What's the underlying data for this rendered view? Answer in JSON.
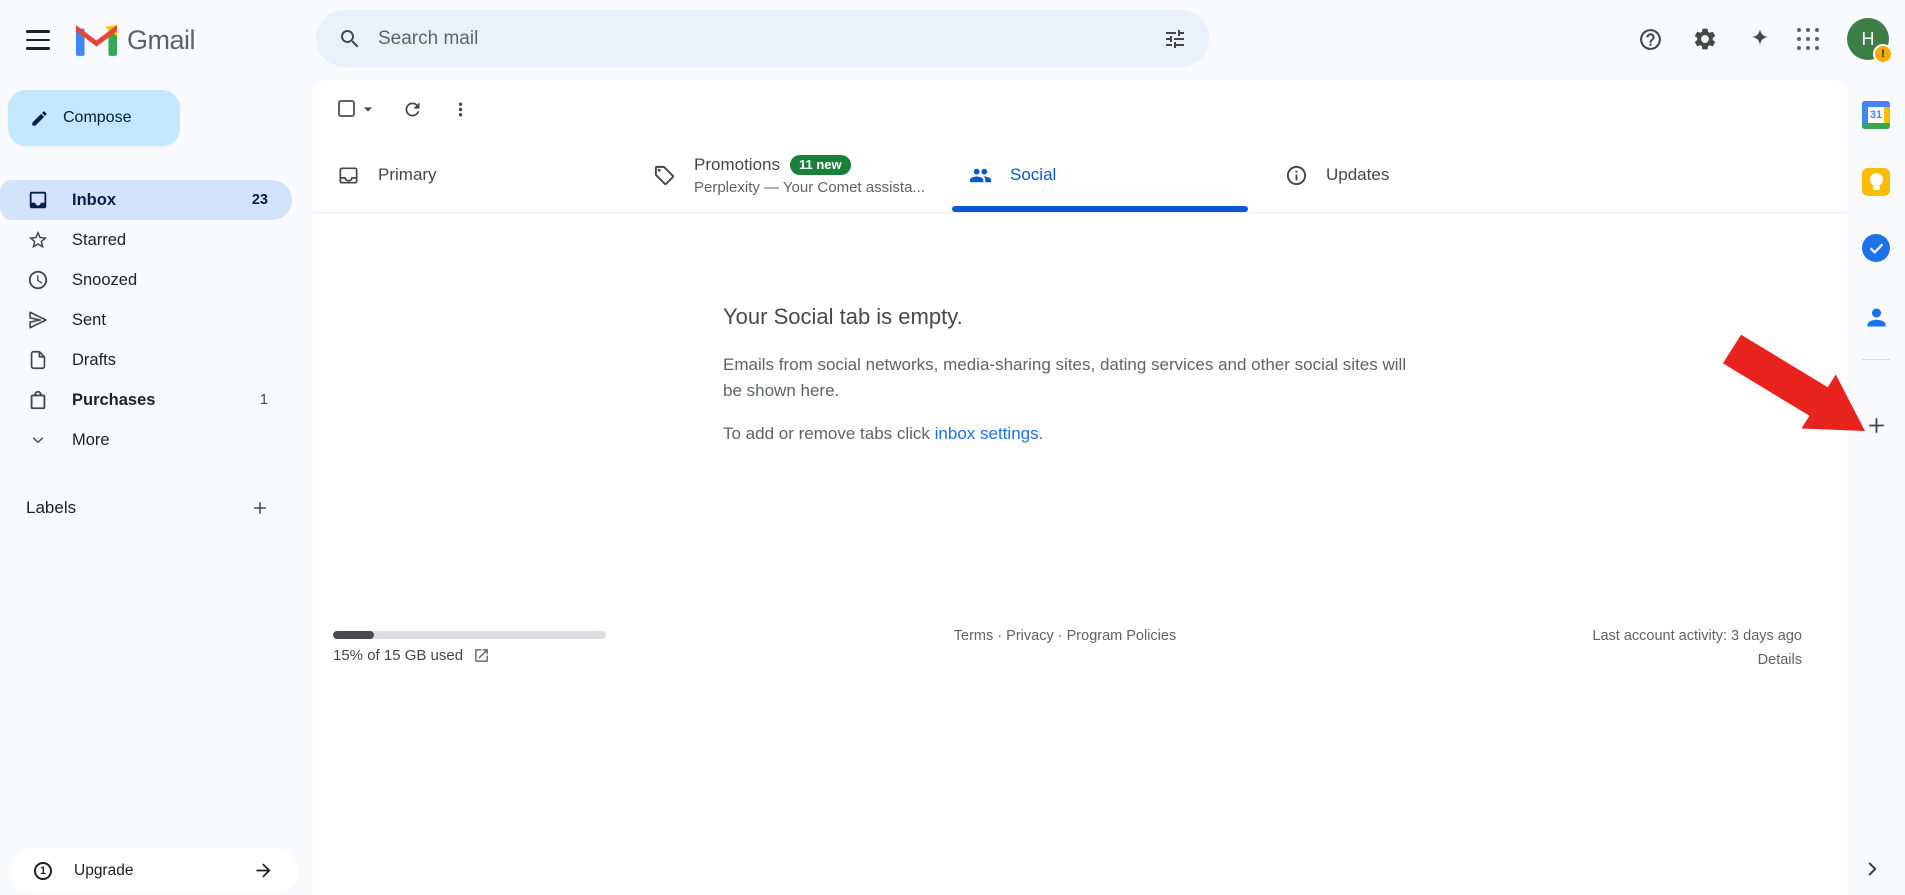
{
  "header": {
    "app_name": "Gmail",
    "search_placeholder": "Search mail",
    "avatar_letter": "H",
    "avatar_badge": "!"
  },
  "sidebar": {
    "compose": "Compose",
    "items": [
      {
        "label": "Inbox",
        "count": "23"
      },
      {
        "label": "Starred",
        "count": ""
      },
      {
        "label": "Snoozed",
        "count": ""
      },
      {
        "label": "Sent",
        "count": ""
      },
      {
        "label": "Drafts",
        "count": ""
      },
      {
        "label": "Purchases",
        "count": "1"
      },
      {
        "label": "More",
        "count": ""
      }
    ],
    "labels_title": "Labels",
    "upgrade": {
      "label": "Upgrade",
      "badge": "1"
    }
  },
  "tabs": {
    "primary": {
      "label": "Primary"
    },
    "promotions": {
      "label": "Promotions",
      "badge": "11 new",
      "preview": "Perplexity — Your Comet assista..."
    },
    "social": {
      "label": "Social"
    },
    "updates": {
      "label": "Updates"
    }
  },
  "empty_state": {
    "title": "Your Social tab is empty.",
    "description": "Emails from social networks, media-sharing sites, dating services and other social sites will be shown here.",
    "cta_prefix": "To add or remove tabs click ",
    "cta_link": "inbox settings",
    "cta_suffix": "."
  },
  "footer": {
    "storage_text": "15% of 15 GB used",
    "storage_percent": 15,
    "links": [
      "Terms",
      "Privacy",
      "Program Policies"
    ],
    "separator": "·",
    "activity": "Last account activity: 3 days ago",
    "details": "Details"
  },
  "side_panel": {
    "calendar_day": "31"
  },
  "colors": {
    "accent_blue": "#0b57d0",
    "badge_green": "#188038",
    "annotation_red": "#e8231e"
  }
}
